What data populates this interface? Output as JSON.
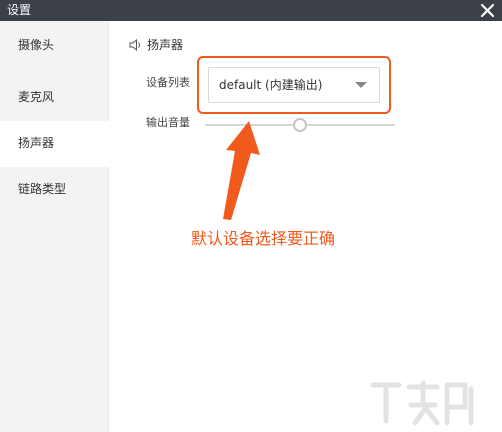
{
  "window": {
    "title": "设置"
  },
  "sidebar": {
    "items": [
      {
        "label": "摄像头",
        "active": false
      },
      {
        "label": "麦克风",
        "active": false
      },
      {
        "label": "扬声器",
        "active": true
      },
      {
        "label": "链路类型",
        "active": false
      }
    ]
  },
  "main": {
    "section_title": "扬声器",
    "device_list_label": "设备列表",
    "device_selected": "default (内建输出)",
    "output_volume_label": "输出音量",
    "output_volume_level": 0.5
  },
  "annotation": {
    "text": "默认设备选择要正确",
    "color": "#f05a1c"
  },
  "colors": {
    "titlebar": "#3b4049",
    "sidebar_bg": "#f3f3f4",
    "accent_annotation": "#f05a1c"
  },
  "icons": {
    "close": "close-icon",
    "speaker": "speaker-icon",
    "dropdown": "chevron-down-icon",
    "arrow": "arrow-up-icon"
  }
}
